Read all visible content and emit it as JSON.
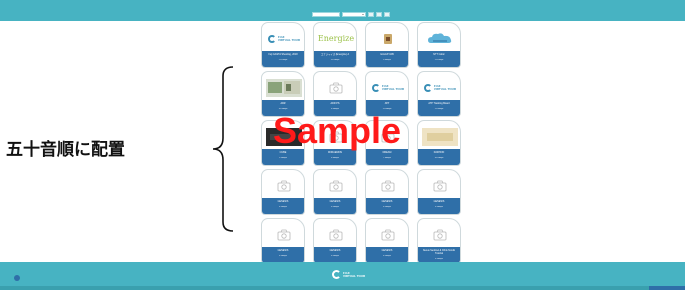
{
  "header": {
    "title": "",
    "search_placeholder": "",
    "select_value": ""
  },
  "cards": [
    {
      "name": "Fuji GASTA Shooting, 2018",
      "meta": "11.1Mbps",
      "thumb": "brand"
    },
    {
      "name": "エナジャイズ (Energize) A",
      "meta": "15.2Mbps",
      "thumb": "energize"
    },
    {
      "name": "GALAXY-DB",
      "meta": "9.8Mbps",
      "thumb": "shield"
    },
    {
      "name": "NTT Cubic",
      "meta": "11.1Mbps",
      "thumb": "cloud"
    },
    {
      "name": "ADR",
      "meta": "10.5Mbps",
      "thumb": "photo"
    },
    {
      "name": "ADR PS",
      "meta": "8.4Mbps",
      "thumb": "placeholder"
    },
    {
      "name": "ATP",
      "meta": "12.0Mbps",
      "thumb": "brand"
    },
    {
      "name": "ATP Tracking Board",
      "meta": "11.3Mbps",
      "thumb": "brand"
    },
    {
      "name": "CUBE",
      "meta": "9.9Mbps",
      "thumb": "dark"
    },
    {
      "name": "DORAEMON",
      "meta": "8.8Mbps",
      "thumb": "placeholder"
    },
    {
      "name": "DREAM",
      "meta": "7.6Mbps",
      "thumb": "placeholder"
    },
    {
      "name": "FASHION",
      "meta": "10.1Mbps",
      "thumb": "beige"
    },
    {
      "name": "GENESIS",
      "meta": "6.5Mbps",
      "thumb": "placeholder"
    },
    {
      "name": "GENESIS",
      "meta": "6.5Mbps",
      "thumb": "placeholder"
    },
    {
      "name": "GENESIS",
      "meta": "6.5Mbps",
      "thumb": "placeholder"
    },
    {
      "name": "GENESIS",
      "meta": "6.5Mbps",
      "thumb": "placeholder"
    },
    {
      "name": "GENESIS",
      "meta": "6.5Mbps",
      "thumb": "placeholder"
    },
    {
      "name": "GENESIS",
      "meta": "6.5Mbps",
      "thumb": "placeholder"
    },
    {
      "name": "GENESIS",
      "meta": "6.5Mbps",
      "thumb": "placeholder"
    },
    {
      "name": "Nexus Sentinel & Orbis Nordic Tutorial",
      "meta": "6.5Mbps",
      "thumb": "placeholder"
    }
  ],
  "brand": {
    "line1": "FUJI",
    "line2": "VIRTUAL TOUR"
  },
  "energize_text": "Energize",
  "annotation": {
    "label": "五十音順に配置"
  },
  "watermark": "Sample",
  "footer": {
    "left_text": "",
    "logo_line1": "FUJI",
    "logo_line2": "VIRTUAL TOUR"
  },
  "colors": {
    "accent": "#47b3c2",
    "card_footer": "#2f6fa8",
    "watermark": "#ff1a1a"
  }
}
